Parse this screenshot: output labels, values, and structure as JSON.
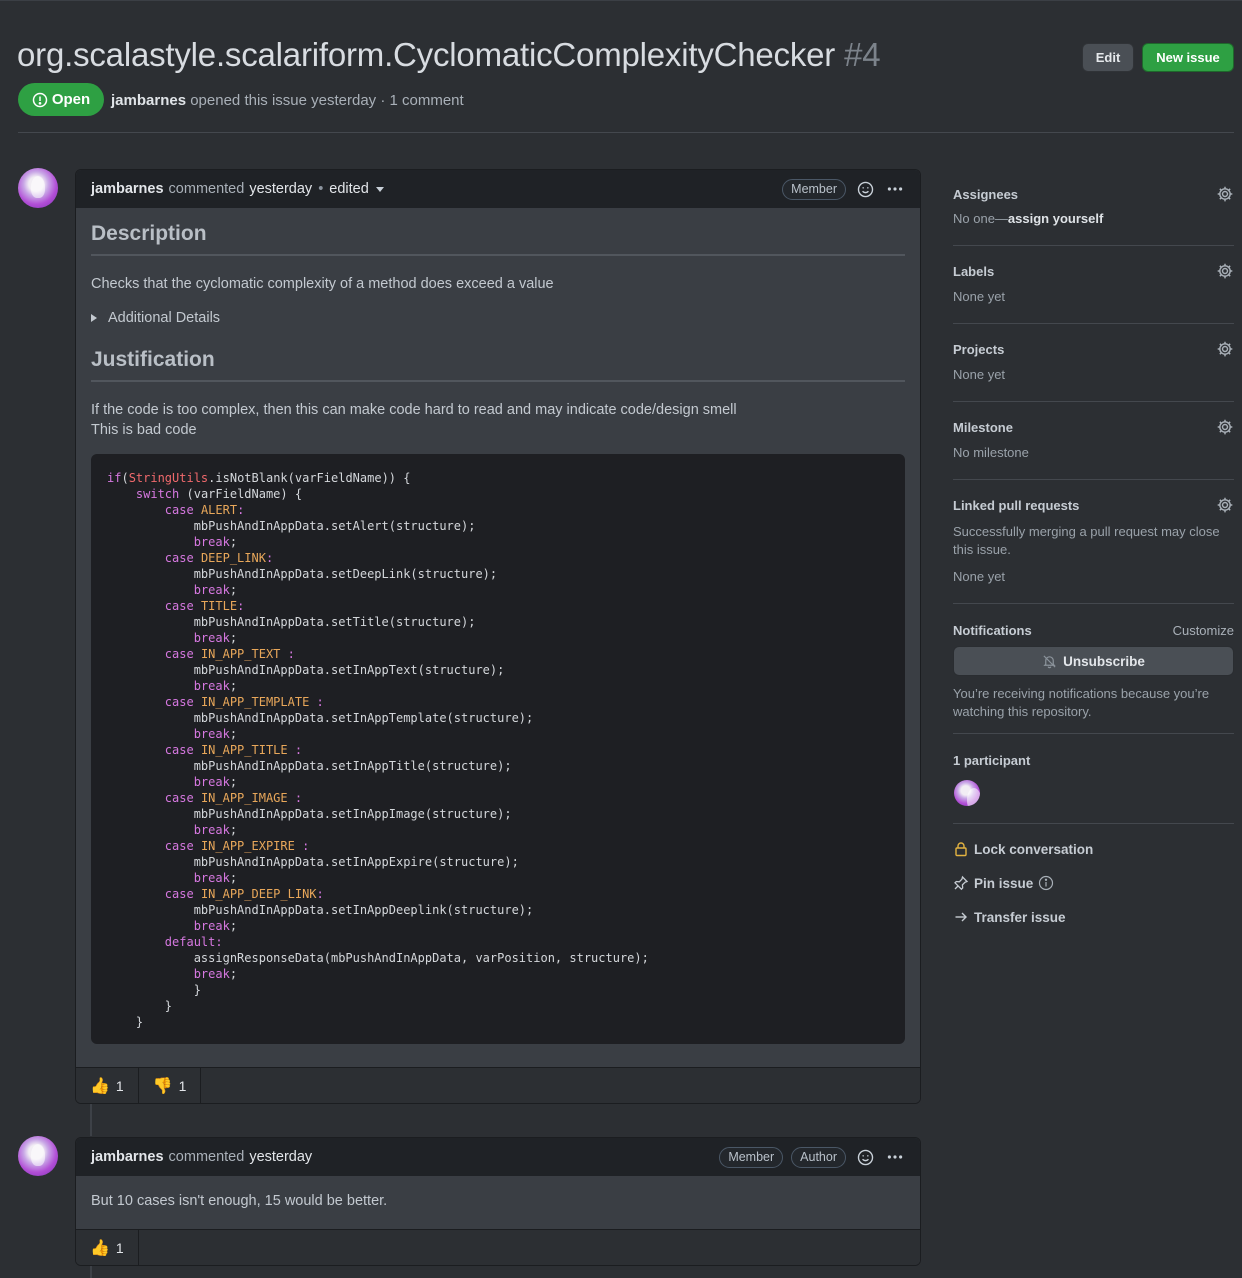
{
  "issue": {
    "title": "org.scalastyle.scalariform.CyclomaticComplexityChecker",
    "number": "#4",
    "state": "Open",
    "author": "jambarnes",
    "meta_rest": "opened this issue yesterday · 1 comment"
  },
  "header_buttons": {
    "edit": "Edit",
    "new_issue": "New issue"
  },
  "comments": [
    {
      "author": "jambarnes",
      "action": "commented",
      "when": "yesterday",
      "edited": "edited",
      "badges": [
        "Member"
      ],
      "body": {
        "heading1": "Description",
        "p1": "Checks that the cyclomatic complexity of a method does exceed a value",
        "details_summary": "Additional Details",
        "heading2": "Justification",
        "p2_line1": "If the code is too complex, then this can make code hard to read and may indicate code/design smell",
        "p2_line2": "This is bad code"
      },
      "reactions": [
        {
          "emoji": "👍",
          "count": "1"
        },
        {
          "emoji": "👎",
          "count": "1"
        }
      ]
    },
    {
      "author": "jambarnes",
      "action": "commented",
      "when": "yesterday",
      "badges": [
        "Member",
        "Author"
      ],
      "body": {
        "p1": "But 10 cases isn't enough, 15 would be better."
      },
      "reactions": [
        {
          "emoji": "👍",
          "count": "1"
        }
      ]
    }
  ],
  "code_lines": [
    [
      [
        "kw",
        "if"
      ],
      [
        "",
        "("
      ],
      [
        "cls",
        "StringUtils"
      ],
      [
        "",
        ".isNotBlank(varFieldName)) {"
      ]
    ],
    [
      [
        "",
        "    "
      ],
      [
        "kw",
        "switch"
      ],
      [
        "",
        "",
        " (varFieldName) {"
      ]
    ],
    [
      [
        "",
        "        "
      ],
      [
        "kw",
        "case"
      ],
      [
        "",
        " "
      ],
      [
        "cst",
        "ALERT"
      ],
      [
        "kw",
        ":"
      ]
    ],
    [
      [
        "",
        "            mbPushAndInAppData.setAlert(structure);"
      ]
    ],
    [
      [
        "",
        "            "
      ],
      [
        "kw",
        "break"
      ],
      [
        "",
        ";"
      ]
    ],
    [
      [
        "",
        "        "
      ],
      [
        "kw",
        "case"
      ],
      [
        "",
        " "
      ],
      [
        "cst",
        "DEEP_LINK"
      ],
      [
        "kw",
        ":"
      ]
    ],
    [
      [
        "",
        "            mbPushAndInAppData.setDeepLink(structure);"
      ]
    ],
    [
      [
        "",
        "            "
      ],
      [
        "kw",
        "break"
      ],
      [
        "",
        ";"
      ]
    ],
    [
      [
        "",
        "        "
      ],
      [
        "kw",
        "case"
      ],
      [
        "",
        " "
      ],
      [
        "cst",
        "TITLE"
      ],
      [
        "kw",
        ":"
      ]
    ],
    [
      [
        "",
        "            mbPushAndInAppData.setTitle(structure);"
      ]
    ],
    [
      [
        "",
        "            "
      ],
      [
        "kw",
        "break"
      ],
      [
        "",
        ";"
      ]
    ],
    [
      [
        "",
        "        "
      ],
      [
        "kw",
        "case"
      ],
      [
        "",
        " "
      ],
      [
        "cst",
        "IN_APP_TEXT"
      ],
      [
        "kw",
        " :"
      ]
    ],
    [
      [
        "",
        "            mbPushAndInAppData.setInAppText(structure);"
      ]
    ],
    [
      [
        "",
        "            "
      ],
      [
        "kw",
        "break"
      ],
      [
        "",
        ";"
      ]
    ],
    [
      [
        "",
        "        "
      ],
      [
        "kw",
        "case"
      ],
      [
        "",
        " "
      ],
      [
        "cst",
        "IN_APP_TEMPLATE"
      ],
      [
        "kw",
        " :"
      ]
    ],
    [
      [
        "",
        "            mbPushAndInAppData.setInAppTemplate(structure);"
      ]
    ],
    [
      [
        "",
        "            "
      ],
      [
        "kw",
        "break"
      ],
      [
        "",
        ";"
      ]
    ],
    [
      [
        "",
        "        "
      ],
      [
        "kw",
        "case"
      ],
      [
        "",
        " "
      ],
      [
        "cst",
        "IN_APP_TITLE"
      ],
      [
        "kw",
        " :"
      ]
    ],
    [
      [
        "",
        "            mbPushAndInAppData.setInAppTitle(structure);"
      ]
    ],
    [
      [
        "",
        "            "
      ],
      [
        "kw",
        "break"
      ],
      [
        "",
        ";"
      ]
    ],
    [
      [
        "",
        "        "
      ],
      [
        "kw",
        "case"
      ],
      [
        "",
        " "
      ],
      [
        "cst",
        "IN_APP_IMAGE"
      ],
      [
        "kw",
        " :"
      ]
    ],
    [
      [
        "",
        "            mbPushAndInAppData.setInAppImage(structure);"
      ]
    ],
    [
      [
        "",
        "            "
      ],
      [
        "kw",
        "break"
      ],
      [
        "",
        ";"
      ]
    ],
    [
      [
        "",
        "        "
      ],
      [
        "kw",
        "case"
      ],
      [
        "",
        " "
      ],
      [
        "cst",
        "IN_APP_EXPIRE"
      ],
      [
        "kw",
        " :"
      ]
    ],
    [
      [
        "",
        "            mbPushAndInAppData.setInAppExpire(structure);"
      ]
    ],
    [
      [
        "",
        "            "
      ],
      [
        "kw",
        "break"
      ],
      [
        "",
        ";"
      ]
    ],
    [
      [
        "",
        "        "
      ],
      [
        "kw",
        "case"
      ],
      [
        "",
        " "
      ],
      [
        "cst",
        "IN_APP_DEEP_LINK"
      ],
      [
        "kw",
        ":"
      ]
    ],
    [
      [
        "",
        "            mbPushAndInAppData.setInAppDeeplink(structure);"
      ]
    ],
    [
      [
        "",
        "            "
      ],
      [
        "kw",
        "break"
      ],
      [
        "",
        ";"
      ]
    ],
    [
      [
        "",
        "        "
      ],
      [
        "kw",
        "default"
      ],
      [
        "kw",
        ":"
      ]
    ],
    [
      [
        "",
        "            assignResponseData(mbPushAndInAppData, varPosition, structure);"
      ]
    ],
    [
      [
        "",
        "            "
      ],
      [
        "kw",
        "break"
      ],
      [
        "",
        ";"
      ]
    ],
    [
      [
        "",
        "            }"
      ]
    ],
    [
      [
        "",
        "        }"
      ]
    ],
    [
      [
        "",
        "    }"
      ]
    ]
  ],
  "sidebar": {
    "assignees": {
      "title": "Assignees",
      "none": "No one—",
      "assign_link": "assign yourself"
    },
    "labels": {
      "title": "Labels",
      "value": "None yet"
    },
    "projects": {
      "title": "Projects",
      "value": "None yet"
    },
    "milestone": {
      "title": "Milestone",
      "value": "No milestone"
    },
    "linked_prs": {
      "title": "Linked pull requests",
      "desc": "Successfully merging a pull request may close this issue.",
      "value": "None yet"
    },
    "notifications": {
      "title": "Notifications",
      "customize": "Customize",
      "button": "Unsubscribe",
      "reason": "You’re receiving notifications because you’re watching this repository."
    },
    "participants": {
      "title": "1 participant"
    },
    "actions": {
      "lock": "Lock conversation",
      "pin": "Pin issue",
      "transfer": "Transfer issue"
    }
  }
}
